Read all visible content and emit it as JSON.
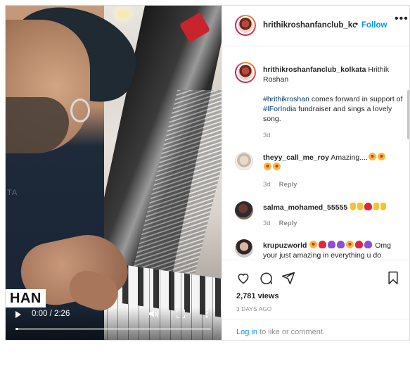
{
  "post": {
    "username": "hrithikroshanfanclub_kolkata",
    "follow_label": "Follow",
    "dot": "•",
    "more": "•••"
  },
  "video": {
    "name_tag": "HAN",
    "shirt_text": "TA",
    "time": "0:00 / 2:26",
    "progress": 0.0
  },
  "caption": {
    "username": "hrithikroshanfanclub_kolkata",
    "text_a": " Hrithik Roshan",
    "hashtag1": "#hrithikroshan",
    "text_b": " comes forward in support of ",
    "hashtag2": "#IForIndia",
    "text_c": " fundraiser and sings a lovely song.",
    "age": "3d"
  },
  "comments": [
    {
      "username": "theyy_call_me_roy",
      "text": " Amazing....",
      "age": "3d",
      "reply": "Reply"
    },
    {
      "username": "salma_mohamed_55555",
      "text": " ",
      "age": "3d",
      "reply": "Reply"
    },
    {
      "username": "krupuzworld",
      "text_end": " Omg your just amazing in everything u do"
    }
  ],
  "stats": {
    "views": "2,781 views",
    "posted": "3 DAYS AGO"
  },
  "login": {
    "link": "Log in",
    "rest": " to like or comment."
  }
}
